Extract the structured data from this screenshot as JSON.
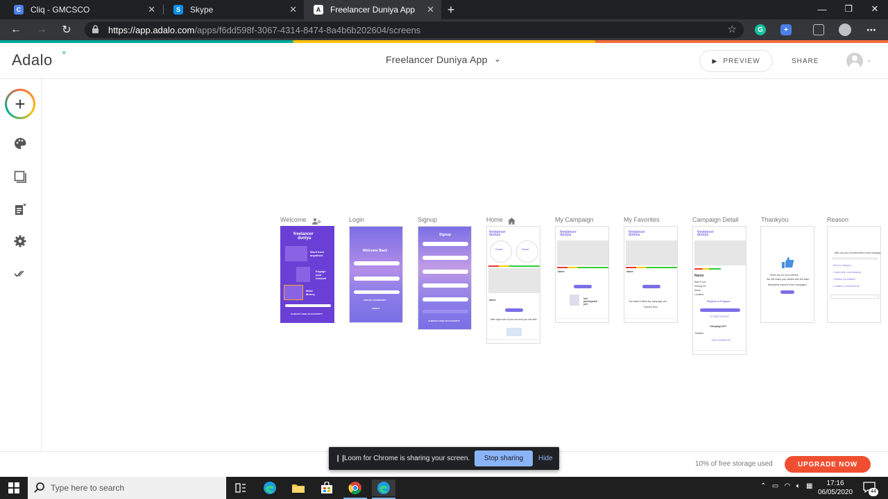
{
  "browser": {
    "tabs": [
      {
        "title": "Cliq - GMCSCO",
        "icon": "cliq-icon",
        "color": "#4a7fe8",
        "letter": "C"
      },
      {
        "title": "Skype",
        "icon": "skype-icon",
        "color": "#0c8fe7",
        "letter": "S"
      },
      {
        "title": "Freelancer Duniya App",
        "icon": "adalo-icon",
        "color": "#ffffff",
        "letter": "A"
      }
    ],
    "url_host": "https://app.adalo.com",
    "url_path": "/apps/f6dd598f-3067-4314-8474-8a4b6b202604/screens"
  },
  "header": {
    "logo": "Adalo",
    "app_title": "Freelancer Duniya App",
    "preview_label": "PREVIEW",
    "share_label": "SHARE"
  },
  "screens": [
    {
      "label": "Welcome"
    },
    {
      "label": "Login"
    },
    {
      "label": "Signup"
    },
    {
      "label": "Home"
    },
    {
      "label": "My Campaign"
    },
    {
      "label": "My Favorites"
    },
    {
      "label": "Campaign Detail"
    },
    {
      "label": "Thankyou"
    },
    {
      "label": "Reason"
    }
  ],
  "footer": {
    "storage": "10% of free storage used",
    "upgrade_label": "UPGRADE NOW"
  },
  "loom": {
    "message": "Loom for Chrome is sharing your screen.",
    "stop_label": "Stop sharing",
    "hide_label": "Hide"
  },
  "taskbar": {
    "search_placeholder": "Type here to search",
    "time": "17:16",
    "date": "06/05/2020",
    "notifications": "44"
  },
  "colors": {
    "accent_teal": "#00a898",
    "accent_yellow": "#ffc00e",
    "accent_orange": "#f36d3c",
    "upgrade": "#f04e30",
    "app_purple": "#7b6fe6"
  }
}
